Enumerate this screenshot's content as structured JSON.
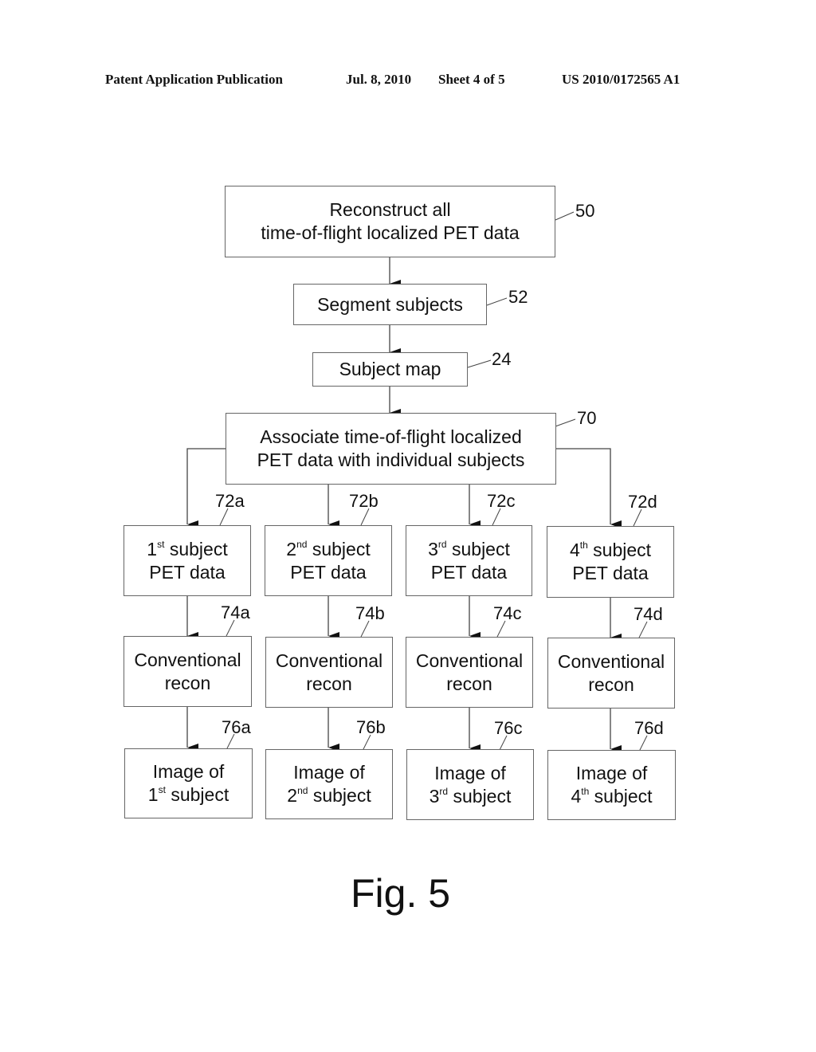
{
  "header": {
    "publication": "Patent Application Publication",
    "date": "Jul. 8, 2010",
    "sheet": "Sheet 4 of 5",
    "number": "US 2010/0172565 A1"
  },
  "steps": {
    "reconstruct": {
      "line1": "Reconstruct all",
      "line2": "time-of-flight localized PET data",
      "ref": "50"
    },
    "segment": {
      "label": "Segment subjects",
      "ref": "52"
    },
    "subject_map": {
      "label": "Subject map",
      "ref": "24"
    },
    "associate": {
      "line1": "Associate time-of-flight localized",
      "line2": "PET data with individual subjects",
      "ref": "70"
    }
  },
  "columns": [
    {
      "ordinal_num": "1",
      "ordinal_suffix": "st",
      "pet": {
        "word": "subject",
        "line2": "PET data",
        "ref": "72a"
      },
      "recon": {
        "line1": "Conventional",
        "line2": "recon",
        "ref": "74a"
      },
      "image": {
        "line1": "Image of",
        "word": "subject",
        "ref": "76a"
      }
    },
    {
      "ordinal_num": "2",
      "ordinal_suffix": "nd",
      "pet": {
        "word": "subject",
        "line2": "PET data",
        "ref": "72b"
      },
      "recon": {
        "line1": "Conventional",
        "line2": "recon",
        "ref": "74b"
      },
      "image": {
        "line1": "Image of",
        "word": "subject",
        "ref": "76b"
      }
    },
    {
      "ordinal_num": "3",
      "ordinal_suffix": "rd",
      "pet": {
        "word": "subject",
        "line2": "PET data",
        "ref": "72c"
      },
      "recon": {
        "line1": "Conventional",
        "line2": "recon",
        "ref": "74c"
      },
      "image": {
        "line1": "Image of",
        "word": "subject",
        "ref": "76c"
      }
    },
    {
      "ordinal_num": "4",
      "ordinal_suffix": "th",
      "pet": {
        "word": "subject",
        "line2": "PET data",
        "ref": "72d"
      },
      "recon": {
        "line1": "Conventional",
        "line2": "recon",
        "ref": "74d"
      },
      "image": {
        "line1": "Image of",
        "word": "subject",
        "ref": "76d"
      }
    }
  ],
  "figure_label": "Fig. 5"
}
